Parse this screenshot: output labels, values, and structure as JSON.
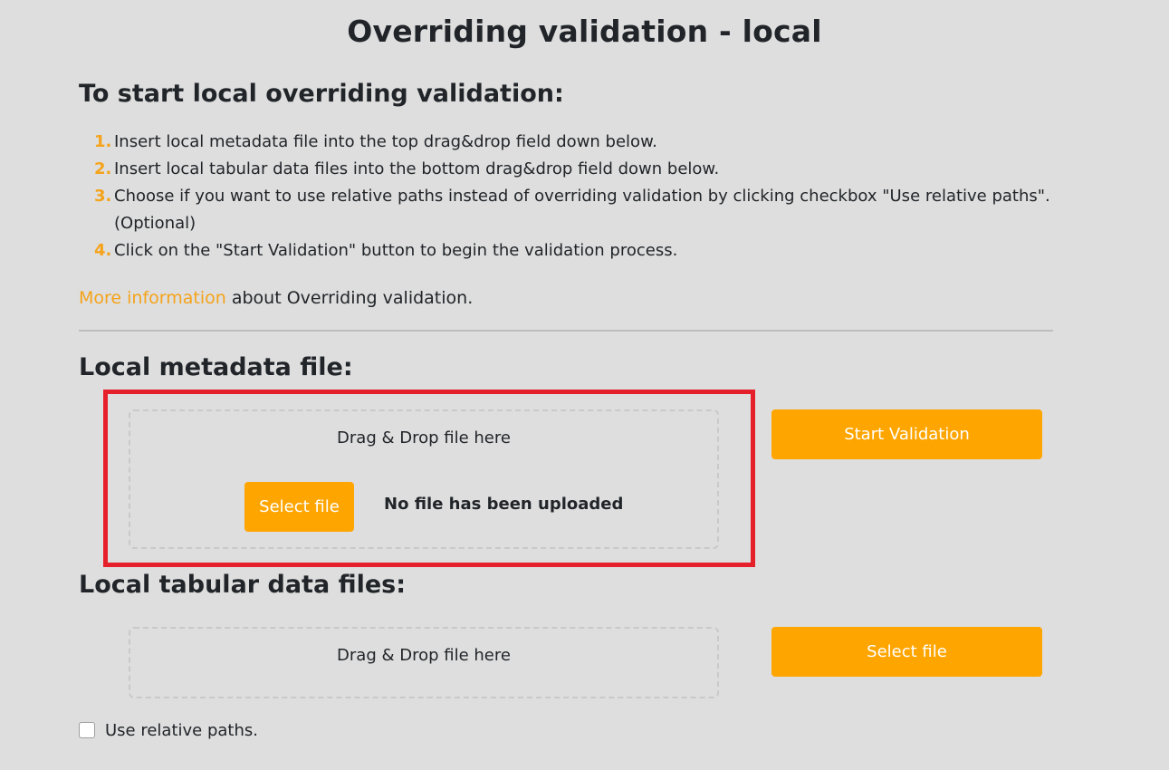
{
  "page_title": "Overriding validation - local",
  "instructions": {
    "heading": "To start local overriding validation:",
    "steps": [
      {
        "number": "1.",
        "text": "Insert local metadata file into the top drag&drop field down below."
      },
      {
        "number": "2.",
        "text": "Insert local tabular data files into the bottom drag&drop field down below."
      },
      {
        "number": "3.",
        "text": "Choose if you want to use relative paths instead of overriding validation by clicking checkbox \"Use relative paths\". (Optional)"
      },
      {
        "number": "4.",
        "text": "Click on the \"Start Validation\" button to begin the validation process."
      }
    ],
    "more_info_link": "More information",
    "more_info_suffix": " about Overriding validation."
  },
  "metadata": {
    "heading": "Local metadata file:",
    "dropzone_text": "Drag & Drop file here",
    "select_button": "Select file",
    "status": "No file has been uploaded",
    "start_button": "Start Validation"
  },
  "tabular": {
    "heading": "Local tabular data files:",
    "dropzone_text": "Drag & Drop file here",
    "select_button": "Select file"
  },
  "relative_paths": {
    "label": "Use relative paths.",
    "checked": false
  },
  "colors": {
    "accent": "#ffa500",
    "link": "#f5a31a",
    "highlight": "#e5202b",
    "background": "#dedede"
  }
}
